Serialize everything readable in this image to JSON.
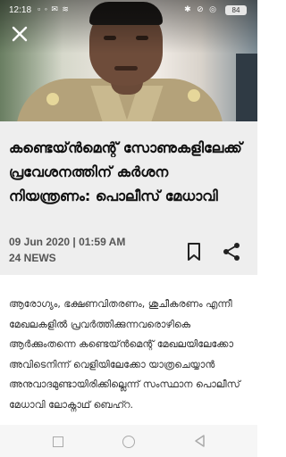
{
  "status_bar": {
    "time": "12:18",
    "left_icons": "▫ ◦ ✉ ≋",
    "right_icons": "✱ ⊘ ◎",
    "battery": "84"
  },
  "close_icon": "close-icon",
  "article": {
    "headline": "കണ്ടെയ്ൻമെന്റ് സോണുകളിലേക്ക് പ്രവേശനത്തിന് കർശന നിയന്ത്രണം: പൊലീസ് മേധാവി",
    "date": "09 Jun 2020 | 01:59 AM",
    "source": "24 NEWS",
    "body": "ആരോഗ്യം, ഭക്ഷണവിതരണം, ശുചീകരണം എന്നീ മേഖലകളിൽ പ്രവർത്തിക്കുന്നവരൊഴികെ ആർക്കുംതന്നെ കണ്ടെയ്ൻമെന്റ് മേഖലയിലേക്കോ അവിടെനിന്ന് വെളിയിലേക്കോ യാത്രചെയ്യാൻ അനുവാദമുണ്ടായിരിക്കില്ലെന്ന് സംസ്ഥാന പൊലീസ് മേധാവി ലോക്നാഥ് ബെഹ്റ."
  },
  "actions": {
    "bookmark_icon": "bookmark-icon",
    "share_icon": "share-icon"
  },
  "nav_bar": {
    "recent_icon": "square-icon",
    "home_icon": "circle-icon",
    "back_icon": "triangle-back-icon"
  },
  "colors": {
    "headline_bg": "#eeeeee",
    "text_dark": "#111111",
    "meta_grey": "#555555"
  }
}
